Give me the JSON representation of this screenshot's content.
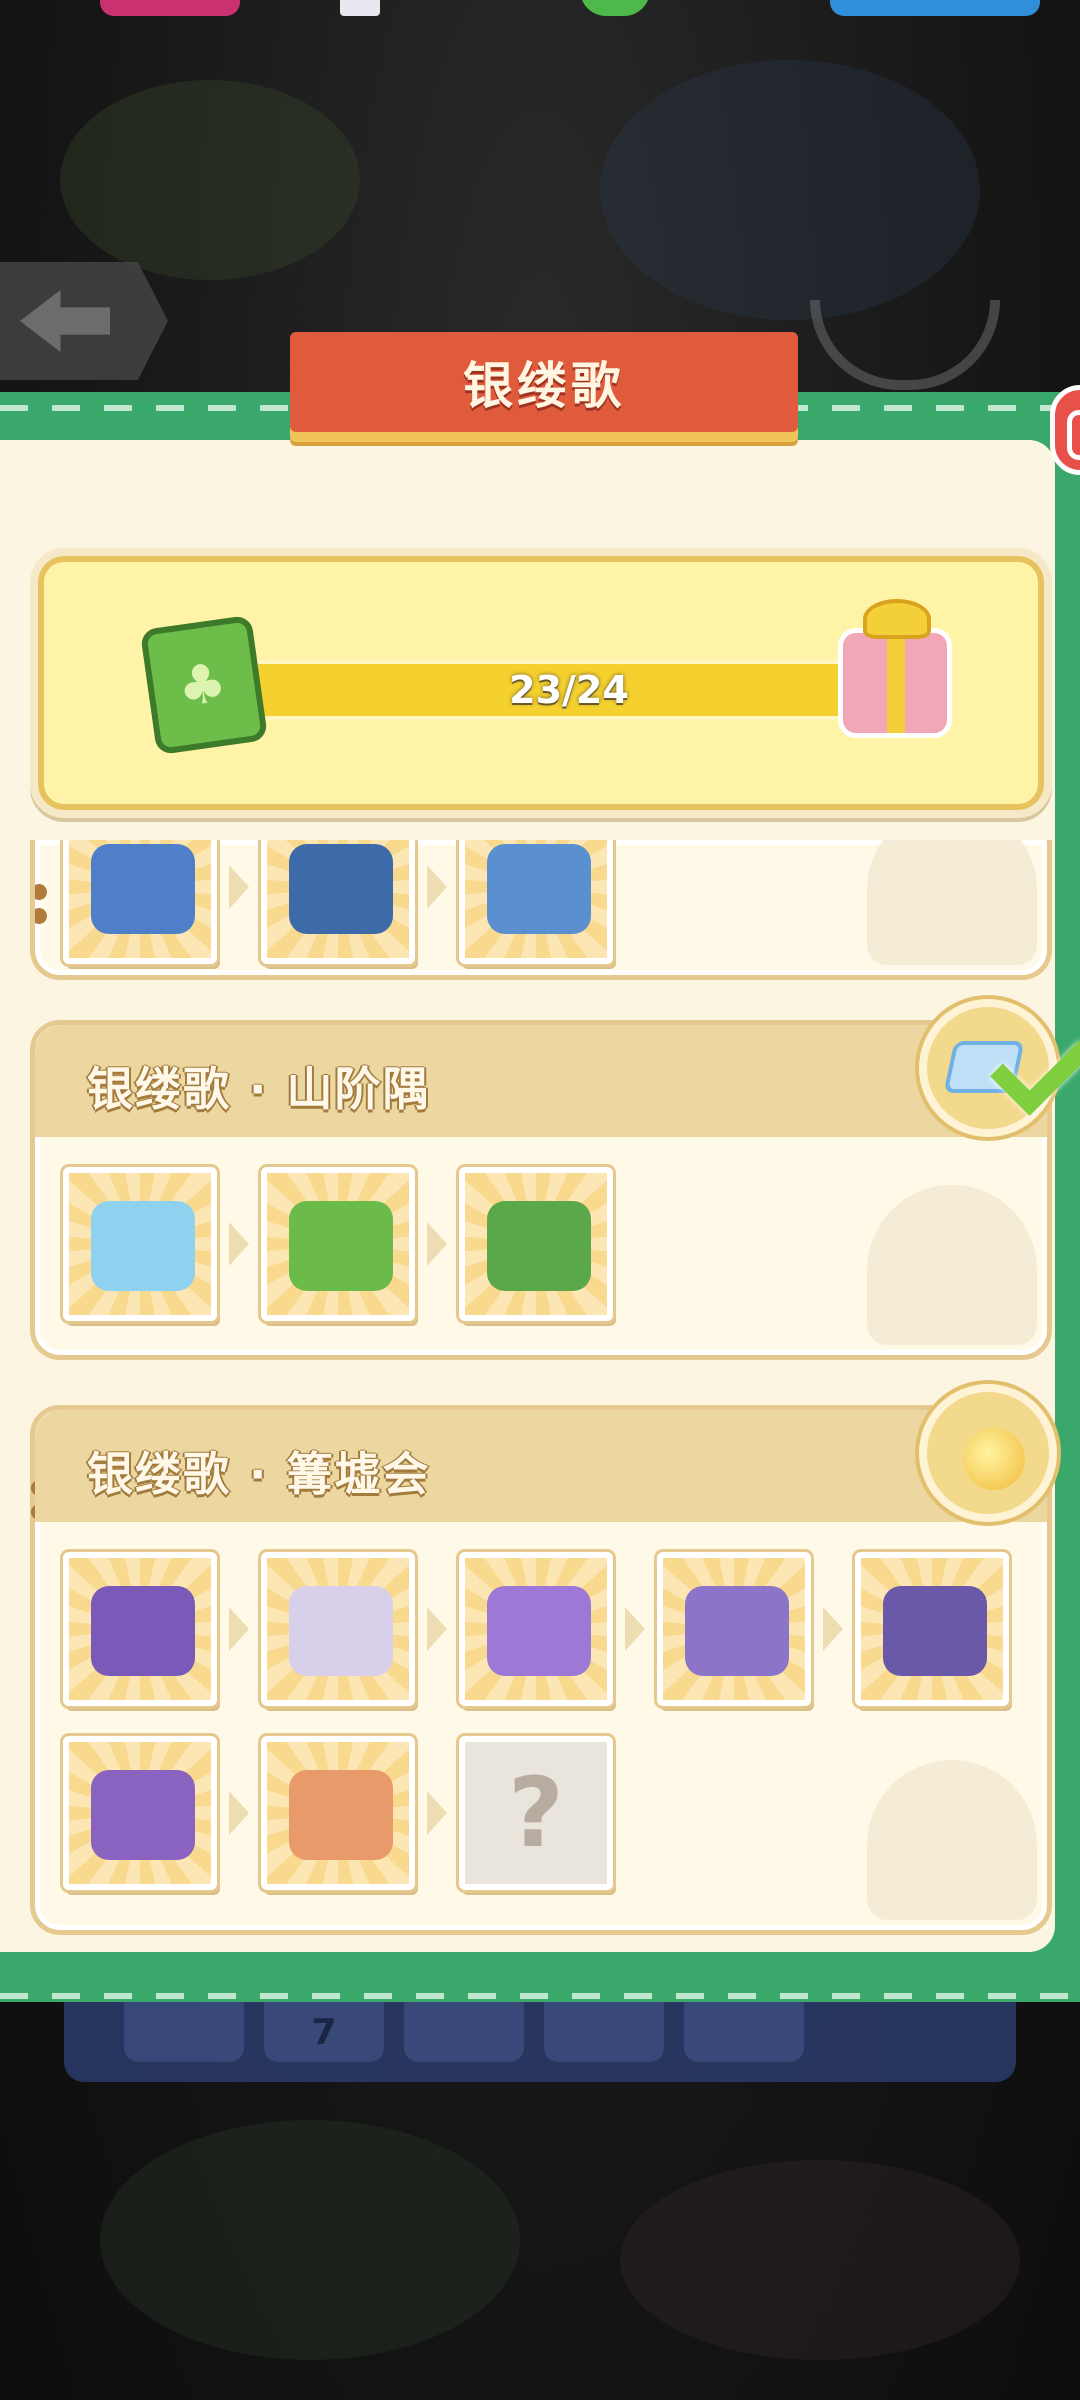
{
  "title": "银缕歌",
  "progress": {
    "current": 23,
    "total": 24,
    "label": "23/24",
    "fraction": 0.958
  },
  "sets": [
    {
      "title": "",
      "items": [
        "blue-pavilion-1",
        "blue-pavilion-2",
        "blue-pavilion-3"
      ],
      "completed": true
    },
    {
      "title": "银缕歌 · 山阶隅",
      "items": [
        "water-tile",
        "grass-steps",
        "mountain-stream"
      ],
      "badge_icon": "crystal-icon",
      "completed": true
    },
    {
      "title": "银缕歌 · 篝墟会",
      "row1": [
        "purple-cushion",
        "silver-hook-ornament",
        "purple-mushroom-stall",
        "purple-folding-fan",
        "silver-scroll-banner"
      ],
      "row2": [
        "purple-cat-pair",
        "colorful-feast",
        "locked"
      ],
      "locked_label": "?",
      "badge_icon": "golden-orb-icon",
      "completed": false
    }
  ],
  "toolbar": {
    "number_label": "7"
  },
  "colors": {
    "frame_green": "#3aa86a",
    "ribbon_red": "#e05a3c",
    "progress_yellow": "#f4d12e",
    "card_header": "#ecd7a1",
    "check_green": "#7fcf3e"
  }
}
